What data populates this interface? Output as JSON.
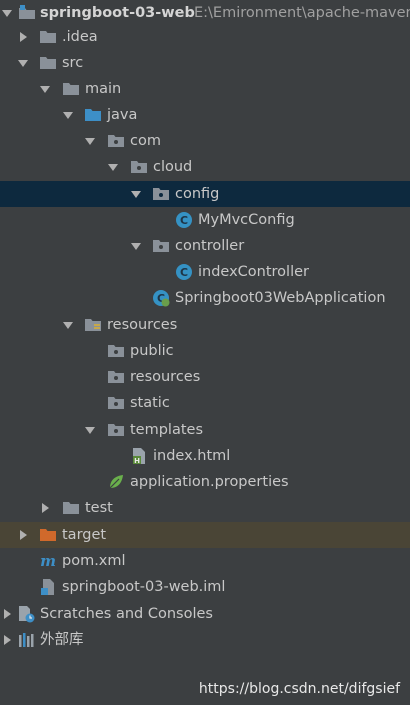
{
  "project": {
    "name": "springboot-03-web",
    "path": "E:\\Emironment\\apache-maven"
  },
  "tree": {
    "idea": ".idea",
    "src": "src",
    "main": "main",
    "java": "java",
    "com": "com",
    "cloud": "cloud",
    "config": "config",
    "mymvcconfig": "MyMvcConfig",
    "controller": "controller",
    "indexcontroller": "indexController",
    "application": "Springboot03WebApplication",
    "resources": "resources",
    "public": "public",
    "resources2": "resources",
    "static": "static",
    "templates": "templates",
    "indexhtml": "index.html",
    "appprops": "application.properties",
    "test": "test",
    "target": "target",
    "pom": "pom.xml",
    "iml": "springboot-03-web.iml",
    "scratches": "Scratches and Consoles",
    "extlibs": "外部库"
  },
  "watermark": "https://blog.csdn.net/difgsief",
  "colors": {
    "selection": "#0d293e",
    "target_row": "#4a4536",
    "folder": "#8a9199",
    "source_folder": "#3d8fc7",
    "class_icon": "#3592c4"
  }
}
